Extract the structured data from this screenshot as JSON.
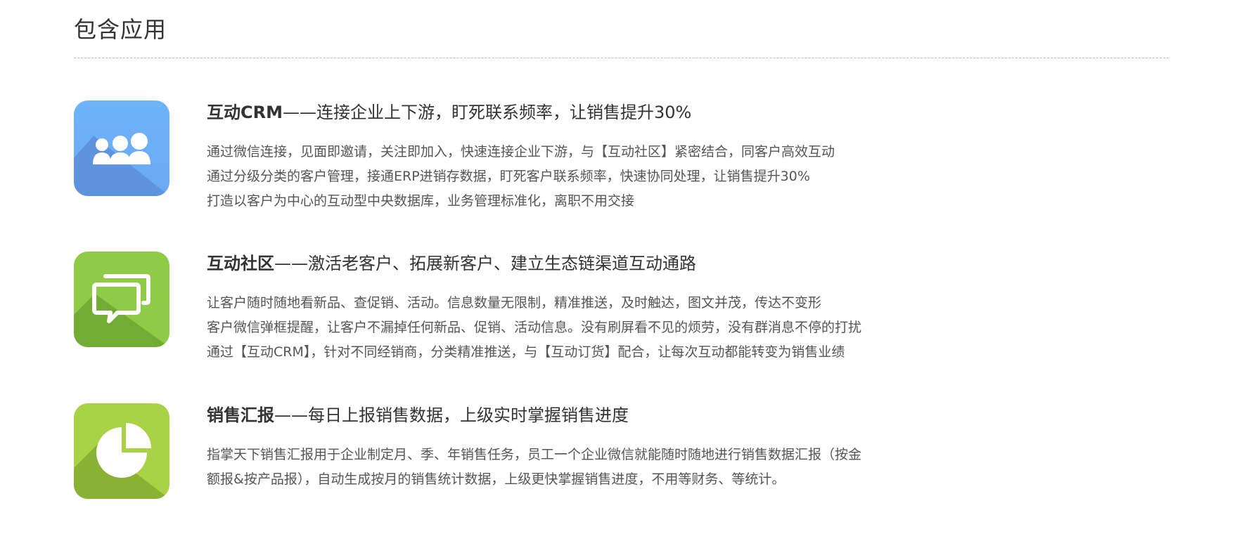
{
  "section": {
    "title": "包含应用"
  },
  "apps": [
    {
      "name": "互动CRM",
      "separator": "——",
      "tagline": "连接企业上下游，盯死联系频率，让销售提升30%",
      "icon": "users-group-icon",
      "color": "#6aaef7",
      "lines": [
        "通过微信连接，见面即邀请，关注即加入，快速连接企业下游，与【互动社区】紧密结合，同客户高效互动",
        "通过分级分类的客户管理，接通ERP进销存数据，盯死客户联系频率，快速协同处理，让销售提升30%",
        "打造以客户为中心的互动型中央数据库，业务管理标准化，离职不用交接"
      ]
    },
    {
      "name": "互动社区",
      "separator": "——",
      "tagline": "激活老客户、拓展新客户、建立生态链渠道互动通路",
      "icon": "chat-bubbles-icon",
      "color": "#8bc940",
      "lines": [
        "让客户随时随地看新品、查促销、活动。信息数量无限制，精准推送，及时触达，图文并茂，传达不变形",
        "客户微信弹框提醒，让客户不漏掉任何新品、促销、活动信息。没有刷屏看不见的烦劳，没有群消息不停的打扰",
        "通过【互动CRM】，针对不同经销商，分类精准推送，与【互动订货】配合，让每次互动都能转变为销售业绩"
      ]
    },
    {
      "name": "销售汇报",
      "separator": "——",
      "tagline": "每日上报销售数据，上级实时掌握销售进度",
      "icon": "pie-chart-icon",
      "color": "#a5cf45",
      "lines": [
        "指掌天下销售汇报用于企业制定月、季、年销售任务，员工一个企业微信就能随时随地进行销售数据汇报（按金",
        "额报&按产品报），自动生成按月的销售统计数据，上级更快掌握销售进度，不用等财务、等统计。"
      ]
    }
  ]
}
